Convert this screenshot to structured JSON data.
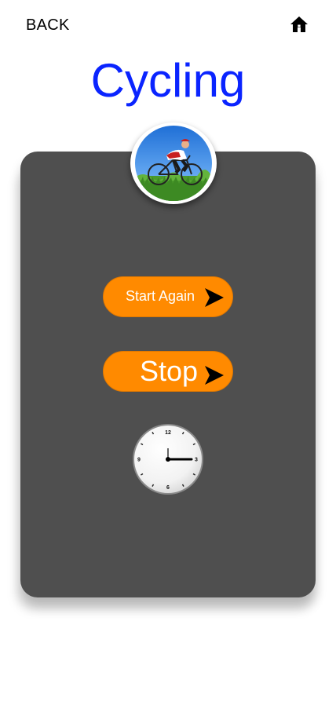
{
  "header": {
    "back_label": "BACK",
    "home_icon": "home-icon"
  },
  "title": "Cycling",
  "workout_image": "cyclist-photo",
  "buttons": {
    "start_again_label": "Start Again",
    "stop_label": "Stop",
    "arrow_icon": "play-arrow-icon"
  },
  "clock": {
    "icon": "clock-icon",
    "numbers": [
      "12",
      "3",
      "6",
      "9"
    ]
  },
  "colors": {
    "title": "#0a24ff",
    "card": "#4f4f4f",
    "button": "#ff8a00",
    "button_text": "#ffffff"
  }
}
